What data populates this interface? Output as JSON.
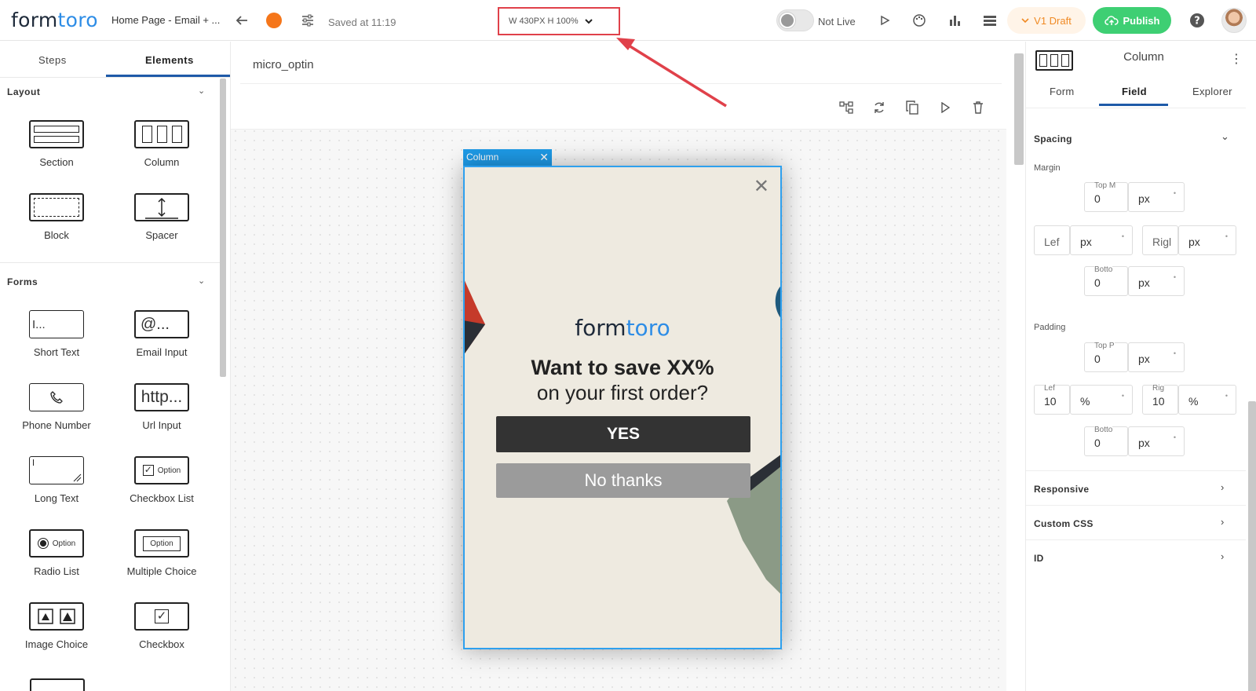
{
  "header": {
    "logo_a": "form",
    "logo_b": "toro",
    "breadcrumb": "Home Page - Email + ...",
    "saved": "Saved at 11:19",
    "dimensions": "W 430PX  H 100%",
    "live_status": "Not Live",
    "draft_label": "V1 Draft",
    "publish_label": "Publish"
  },
  "left_panel": {
    "tabs": [
      "Steps",
      "Elements"
    ],
    "layout_title": "Layout",
    "layout_items": [
      "Section",
      "Column",
      "Block",
      "Spacer"
    ],
    "forms_title": "Forms",
    "form_items": [
      "Short Text",
      "Email Input",
      "Phone Number",
      "Url Input",
      "Long Text",
      "Checkbox List",
      "Radio List",
      "Multiple Choice",
      "Image Choice",
      "Checkbox"
    ],
    "icon_text": {
      "short_text": "I...",
      "email": "@...",
      "url": "http...",
      "option": "Option"
    }
  },
  "canvas": {
    "step_name": "micro_optin",
    "column_label": "Column",
    "popup": {
      "logo_a": "form",
      "logo_b": "toro",
      "headline": "Want to save XX%",
      "subheadline": "on your first order?",
      "yes_label": "YES",
      "no_label": "No thanks"
    }
  },
  "right_panel": {
    "title": "Column",
    "tabs": [
      "Form",
      "Field",
      "Explorer"
    ],
    "spacing_title": "Spacing",
    "margin_title": "Margin",
    "padding_title": "Padding",
    "margin": {
      "top_cap": "Top M",
      "top_val": "0",
      "top_unit": "px",
      "left_val": "Lef",
      "left_unit": "px",
      "right_val": "Rigl",
      "right_unit": "px",
      "bottom_cap": "Botto",
      "bottom_val": "0",
      "bottom_unit": "px"
    },
    "padding": {
      "top_cap": "Top P",
      "top_val": "0",
      "top_unit": "px",
      "left_cap": "Lef",
      "left_val": "10",
      "left_unit": "%",
      "right_cap": "Rig",
      "right_val": "10",
      "right_unit": "%",
      "bottom_cap": "Botto",
      "bottom_val": "0",
      "bottom_unit": "px"
    },
    "collapsibles": [
      "Responsive",
      "Custom CSS",
      "ID"
    ]
  },
  "colors": {
    "brand_blue": "#2e8de6",
    "publish_green": "#3ecf73",
    "draft_orange": "#f08a24",
    "annotation_red": "#e0414a"
  }
}
